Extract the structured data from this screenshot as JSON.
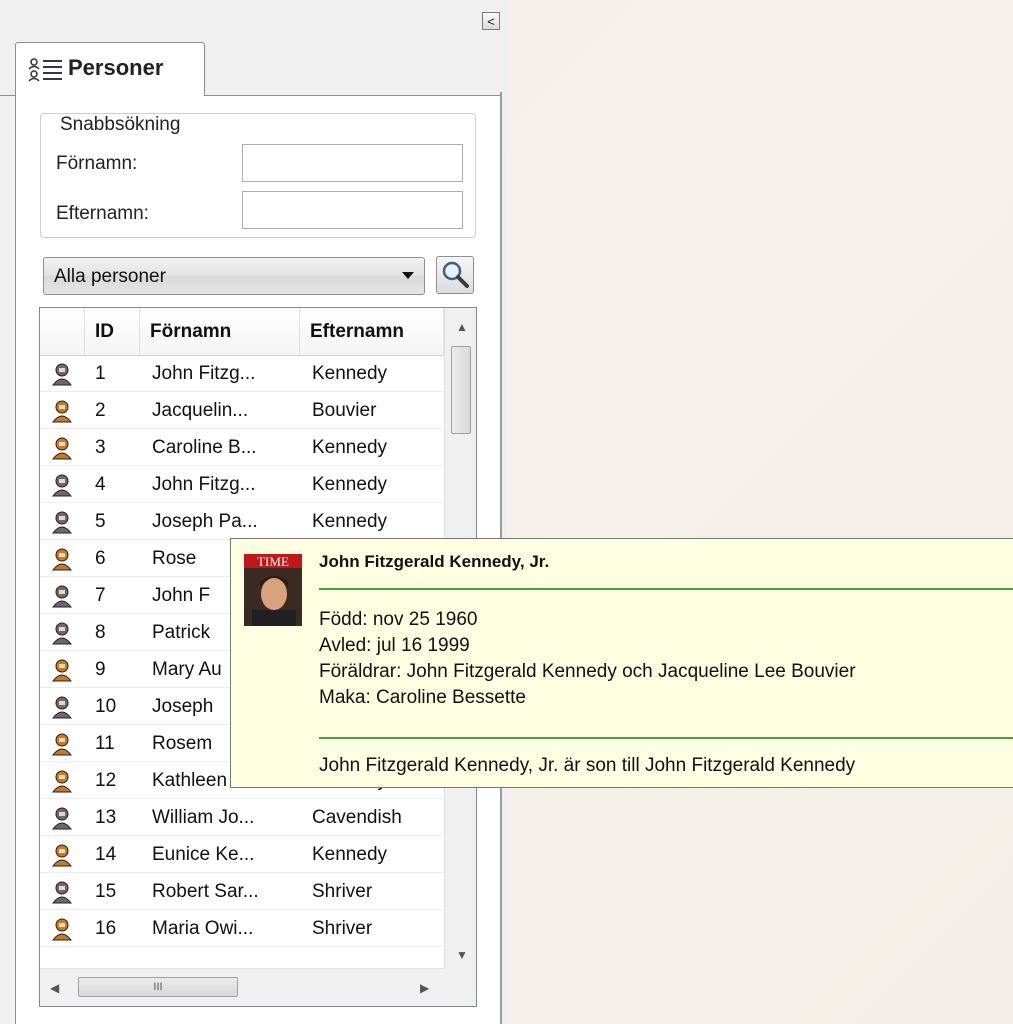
{
  "panel": {
    "collapse_label": "<",
    "tab_label": "Personer"
  },
  "quick_search": {
    "legend": "Snabbsökning",
    "first_name_label": "Förnamn:",
    "first_name_value": "",
    "last_name_label": "Efternamn:",
    "last_name_value": ""
  },
  "filter": {
    "selected": "Alla personer"
  },
  "grid": {
    "columns": [
      "ID",
      "Förnamn",
      "Efternamn"
    ],
    "rows": [
      {
        "id": "1",
        "first": "John Fitzg...",
        "last": "Kennedy",
        "gender": "male"
      },
      {
        "id": "2",
        "first": "Jacquelin...",
        "last": "Bouvier",
        "gender": "female"
      },
      {
        "id": "3",
        "first": "Caroline B...",
        "last": "Kennedy",
        "gender": "female"
      },
      {
        "id": "4",
        "first": "John Fitzg...",
        "last": "Kennedy",
        "gender": "male"
      },
      {
        "id": "5",
        "first": "Joseph Pa...",
        "last": "Kennedy",
        "gender": "male"
      },
      {
        "id": "6",
        "first": "Rose",
        "last": "",
        "gender": "female"
      },
      {
        "id": "7",
        "first": "John F",
        "last": "",
        "gender": "male"
      },
      {
        "id": "8",
        "first": "Patrick",
        "last": "",
        "gender": "male"
      },
      {
        "id": "9",
        "first": "Mary Au",
        "last": "",
        "gender": "female"
      },
      {
        "id": "10",
        "first": "Joseph",
        "last": "",
        "gender": "male"
      },
      {
        "id": "11",
        "first": "Rosem",
        "last": "",
        "gender": "female"
      },
      {
        "id": "12",
        "first": "Kathleen A...",
        "last": "Kennedy",
        "gender": "female"
      },
      {
        "id": "13",
        "first": "William Jo...",
        "last": "Cavendish",
        "gender": "male"
      },
      {
        "id": "14",
        "first": "Eunice Ke...",
        "last": "Kennedy",
        "gender": "female"
      },
      {
        "id": "15",
        "first": "Robert Sar...",
        "last": "Shriver",
        "gender": "male"
      },
      {
        "id": "16",
        "first": "Maria Owi...",
        "last": "Shriver",
        "gender": "female"
      }
    ],
    "hscroll_thumb_glyph": "III"
  },
  "tooltip": {
    "name": "John Fitzgerald Kennedy, Jr.",
    "born": "Född: nov 25 1960",
    "died": "Avled: jul 16 1999",
    "parents": "Föräldrar: John Fitzgerald Kennedy och Jacqueline Lee Bouvier",
    "spouse": "Maka: Caroline Bessette",
    "note": "John Fitzgerald Kennedy, Jr. är son till John Fitzgerald Kennedy",
    "photo_caption": "TIME"
  },
  "colors": {
    "tooltip_bg": "#ffffe1",
    "separator": "#4aa03c",
    "male_icon": "#6a6a6a",
    "female_icon": "#c77a1e"
  }
}
